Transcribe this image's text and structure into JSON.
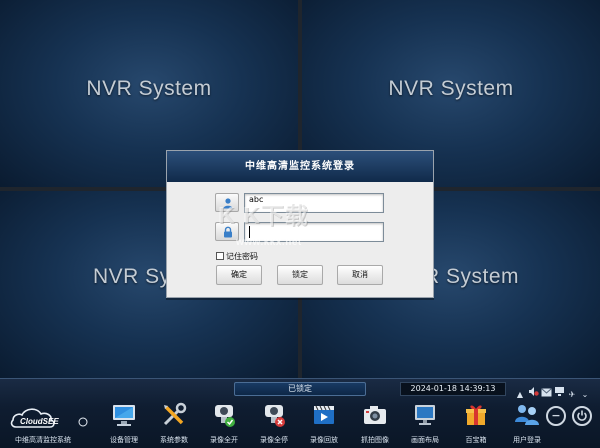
{
  "grid": {
    "tiles": [
      {
        "label": "NVR System"
      },
      {
        "label": "NVR System"
      },
      {
        "label": "NVR Sy"
      },
      {
        "label": "R System"
      }
    ]
  },
  "dialog": {
    "title": "中维高清监控系统登录",
    "username_value": "abc",
    "password_value": "",
    "remember_label": "记住密码",
    "remember_checked": false,
    "buttons": {
      "ok": "确定",
      "lock": "锁定",
      "cancel": "取消"
    }
  },
  "watermark": {
    "logo": "K K下载",
    "url": "www.kkx.net"
  },
  "taskbar": {
    "lock_status": "已锁定",
    "datetime": "2024-01-18 14:39:13",
    "brand": "CloudSEE",
    "system_title": "中维高清监控系统",
    "items": [
      {
        "label": "设备管理",
        "icon": "monitor-icon"
      },
      {
        "label": "系统参数",
        "icon": "tools-icon"
      },
      {
        "label": "录像全开",
        "icon": "camera-record-on-icon"
      },
      {
        "label": "录像全停",
        "icon": "camera-record-stop-icon"
      },
      {
        "label": "录像回放",
        "icon": "film-play-icon"
      },
      {
        "label": "抓拍图像",
        "icon": "snapshot-camera-icon"
      },
      {
        "label": "画面布局",
        "icon": "screen-layout-icon"
      },
      {
        "label": "百宝箱",
        "icon": "gift-box-icon"
      },
      {
        "label": "用户登录",
        "icon": "users-icon"
      }
    ],
    "tray_icons": [
      "eject-icon",
      "speaker-mute-icon",
      "mail-icon",
      "network-icon",
      "pin-icon",
      "collapse-icon"
    ]
  },
  "colors": {
    "tile_bg": "#163252",
    "dialog_header": "#1e3d63",
    "taskbar_bg": "#0f1d31"
  }
}
